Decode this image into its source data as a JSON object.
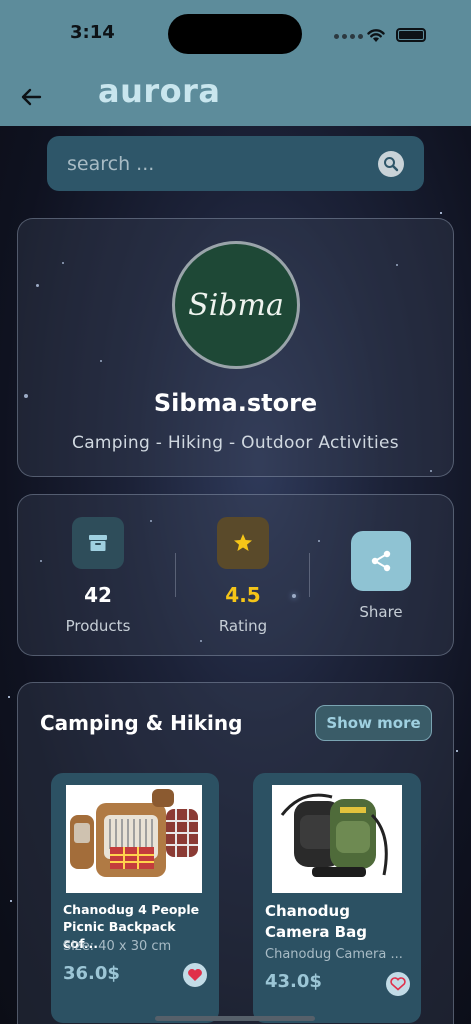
{
  "status_bar": {
    "time": "3:14"
  },
  "header": {
    "brand": "aurora"
  },
  "search": {
    "placeholder": "search ..."
  },
  "store": {
    "avatar_text": "Sibma",
    "name": "Sibma.store",
    "tags": "Camping - Hiking - Outdoor Activities"
  },
  "stats": {
    "products": {
      "value": "42",
      "label": "Products",
      "icon": "archive-icon"
    },
    "rating": {
      "value": "4.5",
      "label": "Rating",
      "icon": "star-icon"
    },
    "share": {
      "label": "Share",
      "icon": "share-icon"
    }
  },
  "section": {
    "title": "Camping & Hiking",
    "show_more": "Show more",
    "products": [
      {
        "title": "Chanodug 4 People Picnic Backpack cof...",
        "subtitle": "Size: 40 x 30 cm",
        "price": "36.0$",
        "favorited": true
      },
      {
        "title": "Chanodug Camera Bag",
        "subtitle": "Chanodug Camera ...",
        "price": "43.0$",
        "favorited": false
      }
    ]
  },
  "colors": {
    "header": "#5d8c9b",
    "accent": "#9cc6d6",
    "rating": "#f5c518",
    "favorite": "#e0304a"
  }
}
